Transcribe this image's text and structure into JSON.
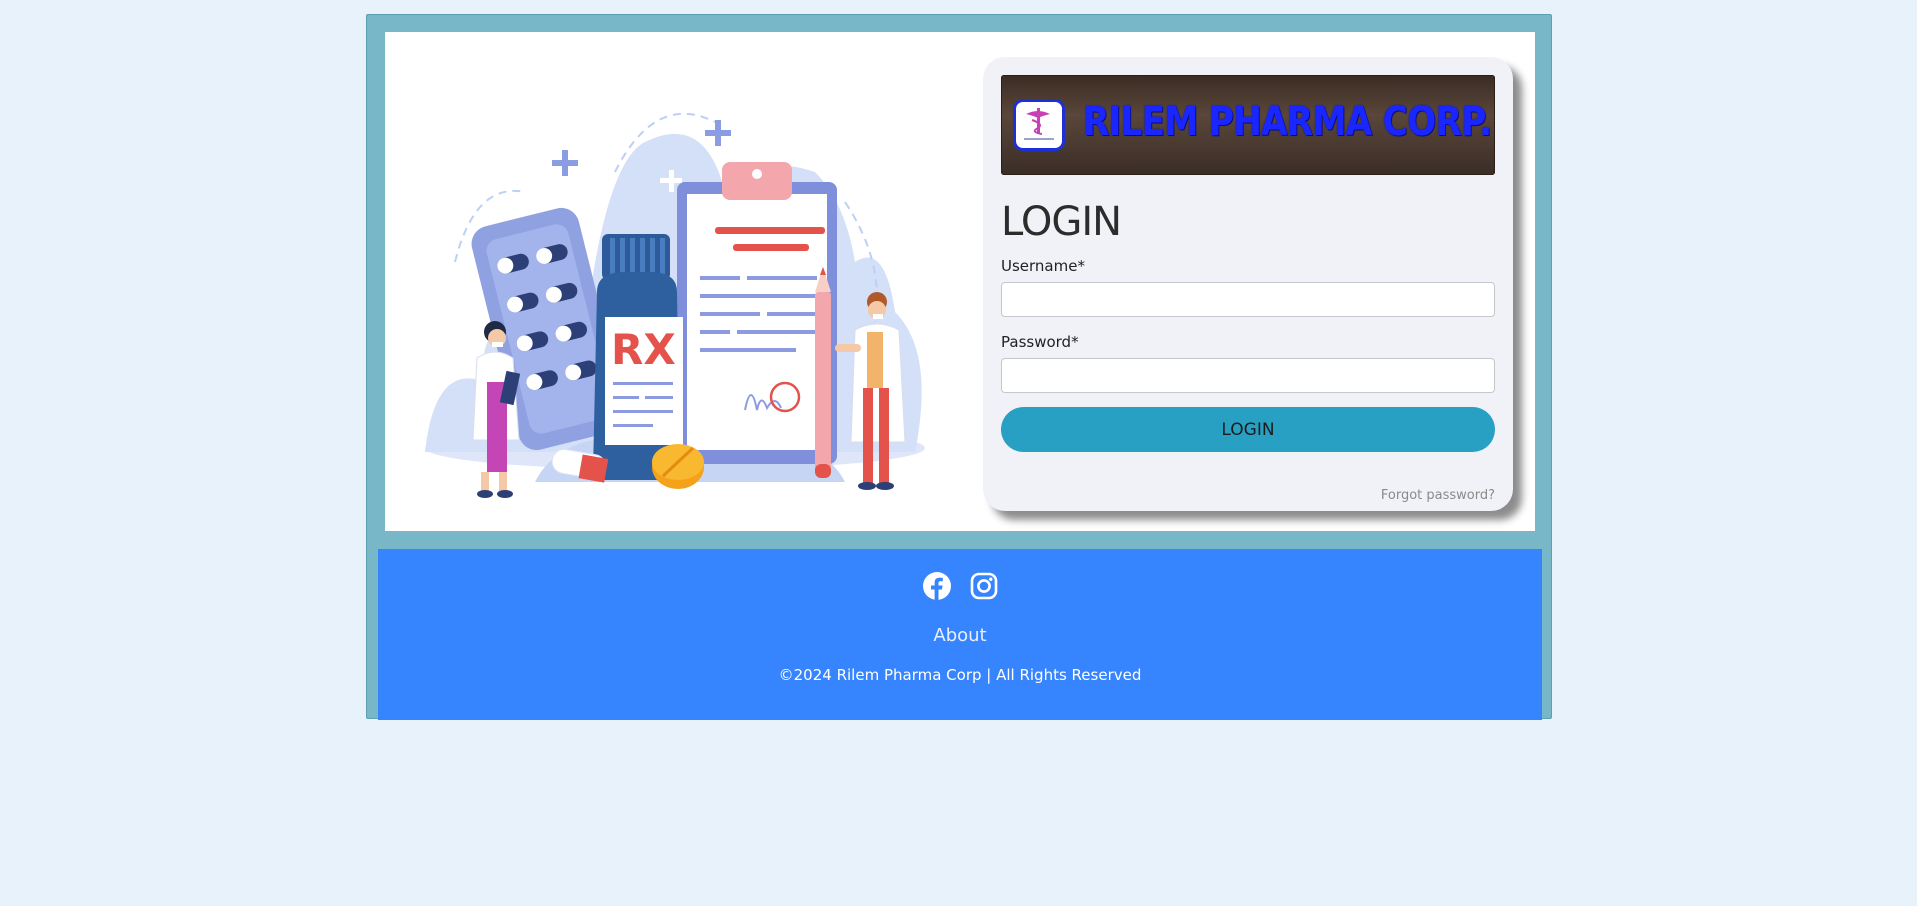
{
  "colors": {
    "page_bg": "#e8f2fa",
    "frame_bg": "#78b7c7",
    "footer_bg": "#3784ff",
    "login_button": "#27a0c3",
    "banner_text": "#1a26ff"
  },
  "banner": {
    "text": "RILEM PHARMA CORP."
  },
  "login": {
    "title": "LOGIN",
    "username_label": "Username*",
    "username_value": "",
    "password_label": "Password*",
    "password_value": "",
    "button_label": "LOGIN",
    "forgot_label": "Forgot password?"
  },
  "illustration": {
    "bottle_label": "RX"
  },
  "footer": {
    "social_icons": [
      "facebook-icon",
      "instagram-icon"
    ],
    "about_label": "About",
    "copyright": "©2024 Rilem Pharma Corp | All Rights Reserved"
  }
}
